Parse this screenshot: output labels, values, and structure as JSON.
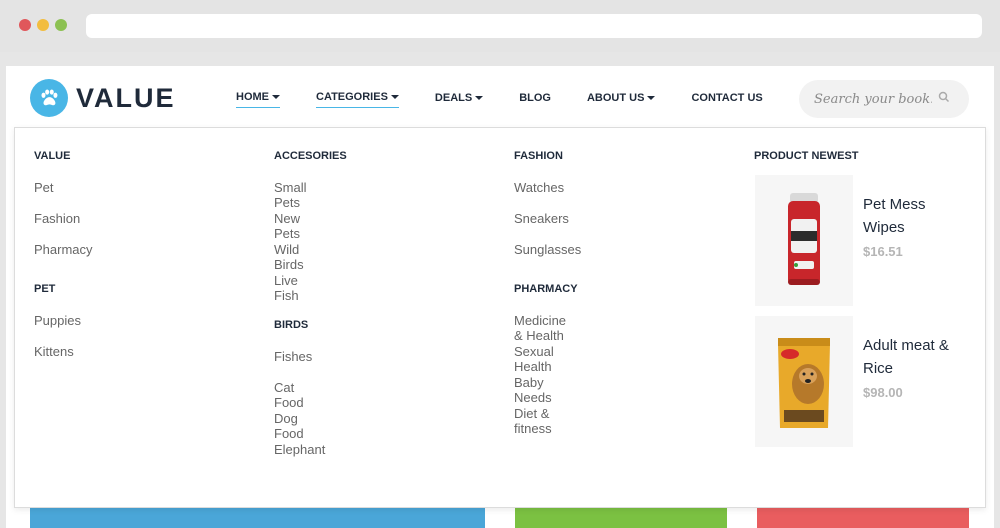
{
  "brand": {
    "name": "VALUE",
    "accent": "#49b6e6"
  },
  "nav": {
    "items": [
      {
        "label": "HOME",
        "dropdown": true,
        "active": true
      },
      {
        "label": "CATEGORIES",
        "dropdown": true,
        "active": true
      },
      {
        "label": "DEALS",
        "dropdown": true,
        "active": false
      },
      {
        "label": "BLOG",
        "dropdown": false,
        "active": false
      },
      {
        "label": "ABOUT US",
        "dropdown": true,
        "active": false
      },
      {
        "label": "CONTACT US",
        "dropdown": false,
        "active": false
      }
    ]
  },
  "search": {
    "placeholder": "Search your book.",
    "icon": "search-icon"
  },
  "mega_menu": {
    "value": {
      "heading": "VALUE",
      "links": [
        "Pet",
        "Fashion",
        "Pharmacy"
      ]
    },
    "pet": {
      "heading": "PET",
      "links": [
        "Puppies",
        "Kittens"
      ]
    },
    "accesories": {
      "heading": "ACCESORIES",
      "links": [
        "Small Pets",
        "New Pets",
        "Wild Birds",
        "Live Fish"
      ]
    },
    "birds": {
      "heading": "BIRDS",
      "links": [
        "Fishes",
        "Cat Food",
        "Dog Food",
        "Elephant"
      ]
    },
    "fashion": {
      "heading": "FASHION",
      "links": [
        "Watches",
        "Sneakers",
        "Sunglasses"
      ]
    },
    "pharmacy": {
      "heading": "PHARMACY",
      "links": [
        "Medicine & Health",
        "Sexual Health",
        "Baby Needs",
        "Diet & fitness"
      ]
    },
    "products": {
      "heading": "PRODUCT NEWEST",
      "items": [
        {
          "name": "Pet Mess Wipes",
          "price": "$16.51"
        },
        {
          "name": "Adult meat & Rice",
          "price": "$98.00"
        }
      ]
    }
  },
  "colors": {
    "strip_blue": "#4aa6d8",
    "strip_green": "#7bc142",
    "strip_red": "#e95d5f"
  }
}
